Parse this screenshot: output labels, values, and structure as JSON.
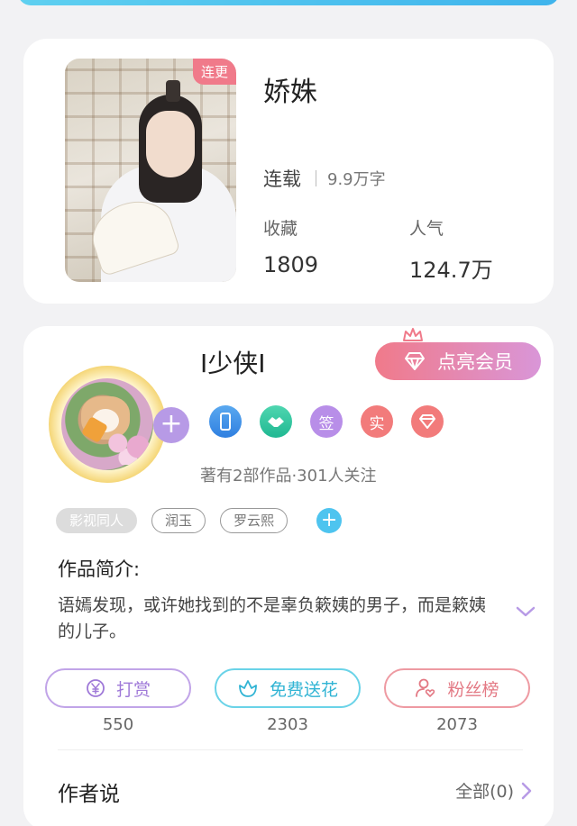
{
  "book": {
    "badge": "连更",
    "title": "娇姝",
    "status": "连载",
    "word_count": "9.9万字",
    "stats": [
      {
        "label": "收藏",
        "value": "1809"
      },
      {
        "label": "人气",
        "value": "124.7万"
      }
    ]
  },
  "author": {
    "name": "I少侠I",
    "vip_button": "点亮会员",
    "medals": [
      {
        "icon": "phone-medal-icon",
        "text": ""
      },
      {
        "icon": "handshake-medal-icon",
        "text": ""
      },
      {
        "icon": "sign-medal-icon",
        "text": "签"
      },
      {
        "icon": "verified-medal-icon",
        "text": "实"
      },
      {
        "icon": "diamond-medal-icon",
        "text": ""
      }
    ],
    "meta": "著有2部作品·301人关注",
    "tags": [
      "影视同人",
      "润玉",
      "罗云熙"
    ],
    "intro_title": "作品简介:",
    "intro_text": "语嫣发现，或许她找到的不是辜负簌姨的男子，而是簌姨的儿子。",
    "actions": [
      {
        "label": "打赏",
        "count": "550",
        "icon": "yen-coin-icon"
      },
      {
        "label": "免费送花",
        "count": "2303",
        "icon": "flower-icon"
      },
      {
        "label": "粉丝榜",
        "count": "2073",
        "icon": "fan-heart-icon"
      }
    ],
    "says_title": "作者说",
    "says_more": "全部(0)"
  },
  "colors": {
    "vip_gradient_start": "#f07a8a",
    "vip_gradient_end": "#d996d8",
    "reward_purple": "#9f79d8",
    "flower_teal": "#31b4d4",
    "fans_pink": "#e37984",
    "tag_add_blue": "#4ec4ef"
  }
}
